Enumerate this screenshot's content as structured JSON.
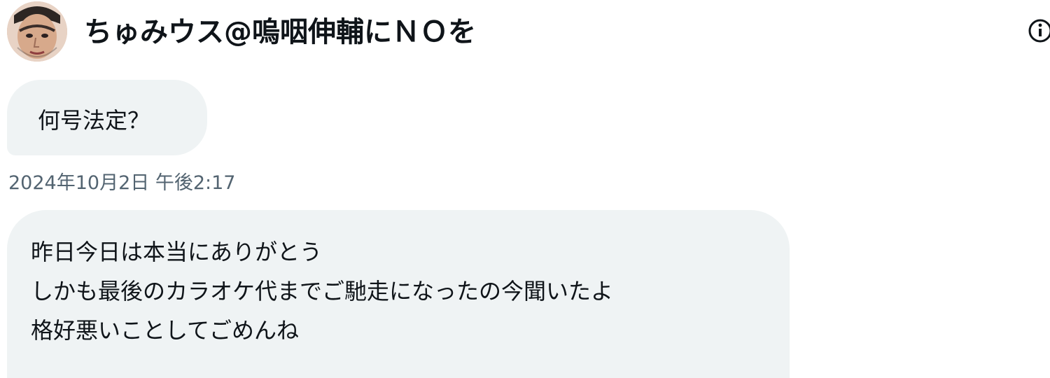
{
  "header": {
    "display_name": "ちゅみウス@嗚咽伸輔にＮＯを",
    "avatar_icon": "user-avatar",
    "info_icon": "info-icon"
  },
  "messages": [
    {
      "text": "何号法定？"
    },
    {
      "timestamp": "2024年10月2日 午後2:17"
    },
    {
      "lines": [
        "昨日今日は本当にありがとう",
        "しかも最後のカラオケ代までご馳走になったの今聞いたよ",
        "格好悪いことしてごめんね"
      ]
    }
  ],
  "colors": {
    "bubble": "#eff3f4",
    "text": "#0f1419",
    "muted": "#536471"
  }
}
